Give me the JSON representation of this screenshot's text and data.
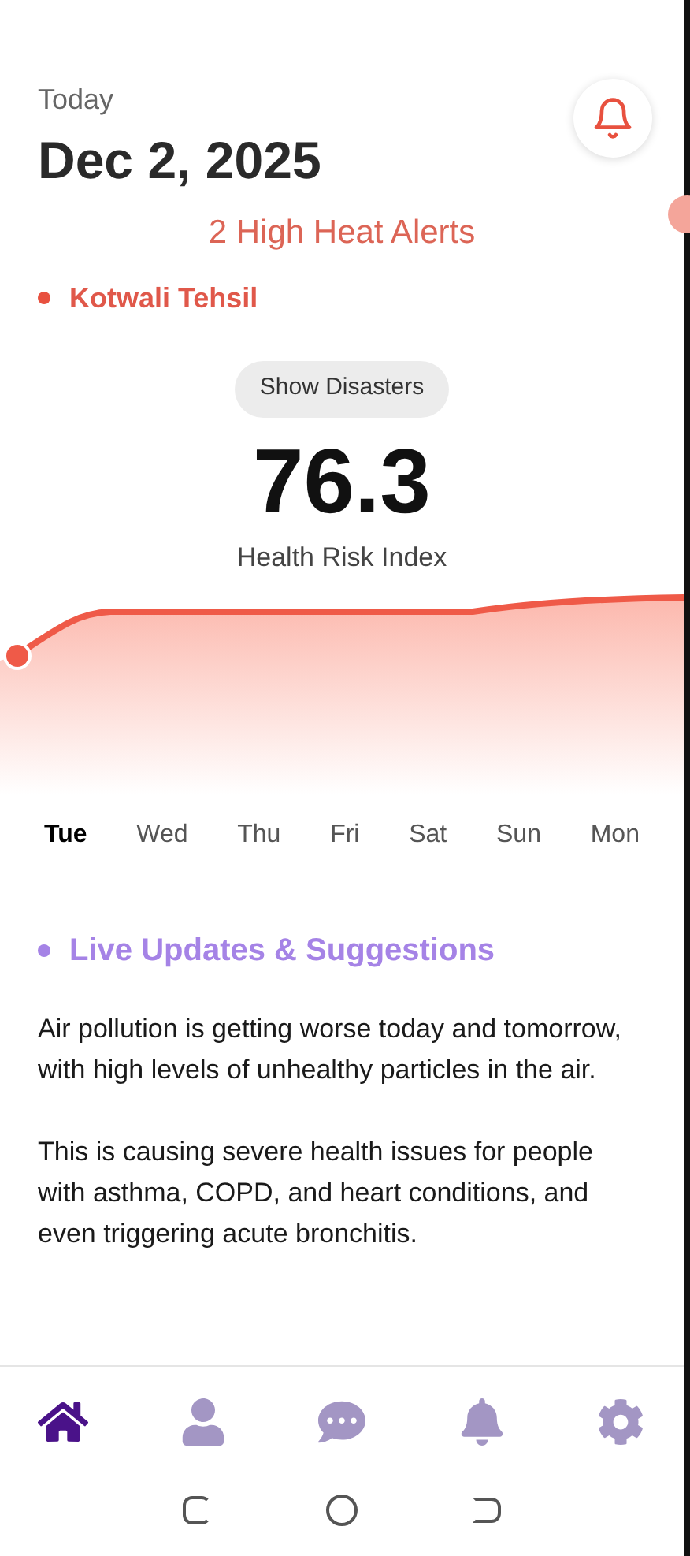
{
  "header": {
    "label": "Today",
    "date": "Dec 2, 2025"
  },
  "alerts": {
    "text": "2 High Heat Alerts"
  },
  "location": {
    "name": "Kotwali Tehsil",
    "color": "#e8513f"
  },
  "show_disasters_button": "Show Disasters",
  "index": {
    "value": "76.3",
    "label": "Health Risk Index"
  },
  "days": [
    {
      "label": "Tue",
      "selected": true
    },
    {
      "label": "Wed",
      "selected": false
    },
    {
      "label": "Thu",
      "selected": false
    },
    {
      "label": "Fri",
      "selected": false
    },
    {
      "label": "Sat",
      "selected": false
    },
    {
      "label": "Sun",
      "selected": false
    },
    {
      "label": "Mon",
      "selected": false
    }
  ],
  "updates": {
    "title": "Live Updates & Suggestions",
    "paragraphs": [
      "Air pollution is getting worse today and tomorrow, with high levels of unhealthy particles in the air.",
      "This is causing severe health issues for people with asthma, COPD, and heart conditions, and even triggering acute bronchitis."
    ]
  },
  "nav": [
    {
      "kind": "home",
      "selected": true
    },
    {
      "kind": "profile",
      "selected": false
    },
    {
      "kind": "chat",
      "selected": false
    },
    {
      "kind": "notifications",
      "selected": false
    },
    {
      "kind": "settings",
      "selected": false
    }
  ]
}
